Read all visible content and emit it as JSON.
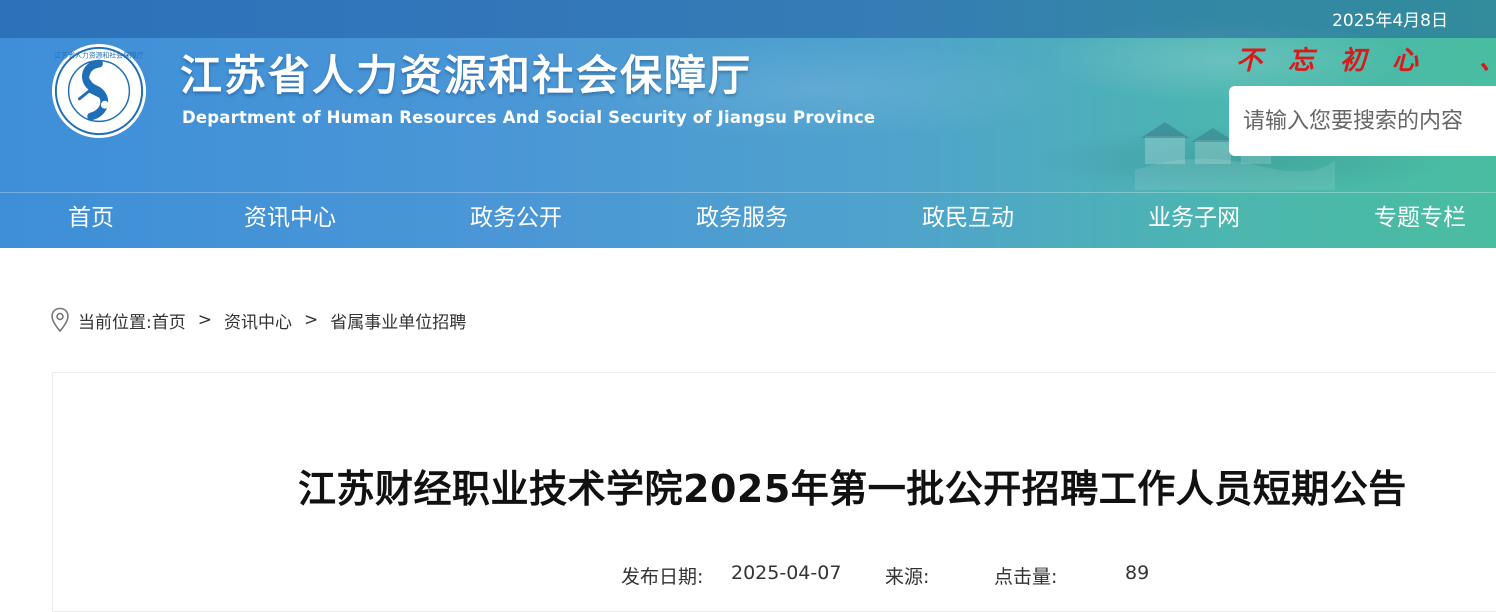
{
  "header": {
    "date": "2025年4月8日",
    "title": "江苏省人力资源和社会保障厅",
    "subtitle": "Department of Human Resources And Social Security of Jiangsu Province",
    "slogan": "不忘初心 、",
    "logo_ring_text": "江苏省人力资源和社会保障厅",
    "search": {
      "placeholder": "请输入您要搜索的内容"
    }
  },
  "nav": {
    "items": [
      {
        "label": "首页"
      },
      {
        "label": "资讯中心"
      },
      {
        "label": "政务公开"
      },
      {
        "label": "政务服务"
      },
      {
        "label": "政民互动"
      },
      {
        "label": "业务子网"
      },
      {
        "label": "专题专栏"
      }
    ]
  },
  "breadcrumb": {
    "prefix": "当前位置:",
    "items": [
      "首页",
      "资讯中心",
      "省属事业单位招聘"
    ],
    "separator": ">"
  },
  "article": {
    "title": "江苏财经职业技术学院2025年第一批公开招聘工作人员短期公告",
    "meta": {
      "date_label": "发布日期:",
      "date": "2025-04-07",
      "source_label": "来源:",
      "views_label": "点击量:",
      "views": "89"
    }
  },
  "colors": {
    "header_start": "#3e8fd8",
    "header_end": "#49bda0",
    "slogan": "#d91a1a",
    "text": "#333333"
  },
  "icons": [
    "logo-emblem",
    "location-pin-icon"
  ]
}
